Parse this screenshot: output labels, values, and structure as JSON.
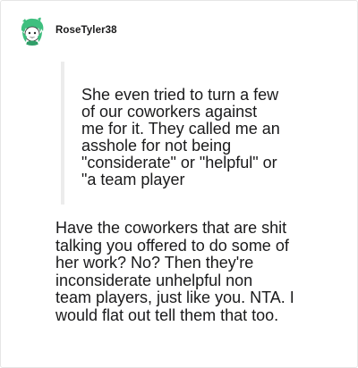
{
  "comment": {
    "username": "RoseTyler38",
    "avatar_icon": "green-haired-character-avatar",
    "quoted_text": "She even tried to turn a few\nof our coworkers against\nme for it. They called me an\nasshole for not being\n\"considerate\" or \"helpful\" or\n\"a team player",
    "reply_text": "Have the coworkers that are shit\ntalking you offered to do some of\nher work? No? Then they're\ninconsiderate unhelpful non\nteam players, just like you. NTA. I\nwould flat out tell them that too."
  },
  "colors": {
    "text": "#1a1a1b",
    "quote_bar": "#ececec",
    "border": "#e6e6e6",
    "avatar_hair": "#3fbf7f"
  }
}
